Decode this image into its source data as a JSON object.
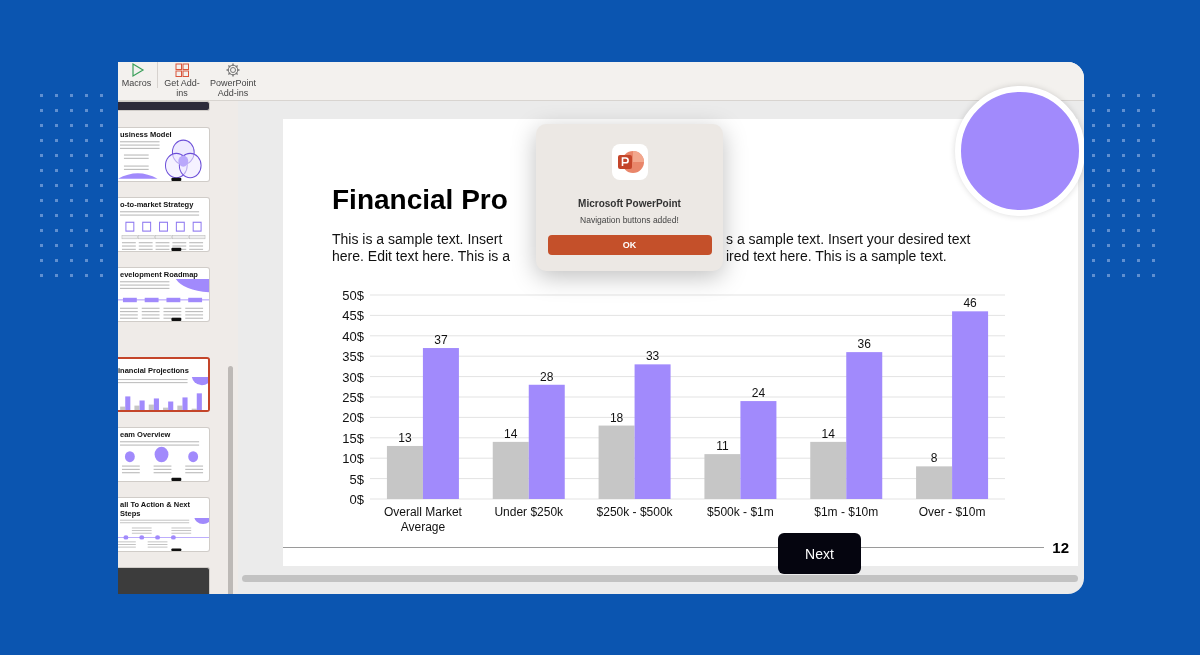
{
  "ribbon": {
    "buttons": [
      {
        "label": "Macros",
        "kind": "macros"
      },
      {
        "label": "Get Add-ins",
        "kind": "addins"
      },
      {
        "label": "PowerPoint Add-ins",
        "kind": "gear"
      }
    ]
  },
  "thumbnails": [
    {
      "kind": "banner",
      "selected": false
    },
    {
      "kind": "venn",
      "title": "usiness Model",
      "selected": false
    },
    {
      "kind": "icons",
      "title": "o-to-market Strategy",
      "selected": false
    },
    {
      "kind": "roadmap",
      "title": "evelopment Roadmap",
      "selected": false
    },
    {
      "kind": "chart",
      "title": "inancial Projections",
      "selected": true
    },
    {
      "kind": "team",
      "title": "eam Overview",
      "selected": false
    },
    {
      "kind": "timeline",
      "title": "all To Action & Next Steps",
      "selected": false
    },
    {
      "kind": "closing",
      "selected": false
    }
  ],
  "slide": {
    "title": "Financial Pro",
    "text_left": [
      "This is a sample text. Insert",
      "here. Edit text here. This is a"
    ],
    "text_right": [
      "s a sample text. Insert your desired text",
      "ired text here. This is a sample text."
    ],
    "chart_data": {
      "type": "bar",
      "categories": [
        "Overall Market Average",
        "Under $250k",
        "$250k - $500k",
        "$500k - $1m",
        "$1m - $10m",
        "Over - $10m"
      ],
      "series": [
        {
          "color": "#c6c6c6",
          "values": [
            13,
            14,
            18,
            11,
            14,
            8
          ]
        },
        {
          "color": "#a18afc",
          "values": [
            37,
            28,
            33,
            24,
            36,
            46
          ]
        }
      ],
      "ylim": [
        0,
        50
      ],
      "yticks": [
        {
          "value": 0,
          "label": "0$"
        },
        {
          "value": 5,
          "label": "5$"
        },
        {
          "value": 10,
          "label": "10$"
        },
        {
          "value": 15,
          "label": "15$"
        },
        {
          "value": 20,
          "label": "20$"
        },
        {
          "value": 25,
          "label": "25$"
        },
        {
          "value": 30,
          "label": "30$"
        },
        {
          "value": 35,
          "label": "35$"
        },
        {
          "value": 40,
          "label": "40$"
        },
        {
          "value": 45,
          "label": "45$"
        },
        {
          "value": 50,
          "label": "50$"
        }
      ],
      "grid": true,
      "data_labels": true
    },
    "page_number": "12",
    "next_button": "Next"
  },
  "dialog": {
    "title": "Microsoft PowerPoint",
    "message": "Navigation buttons added!",
    "button": "OK"
  }
}
